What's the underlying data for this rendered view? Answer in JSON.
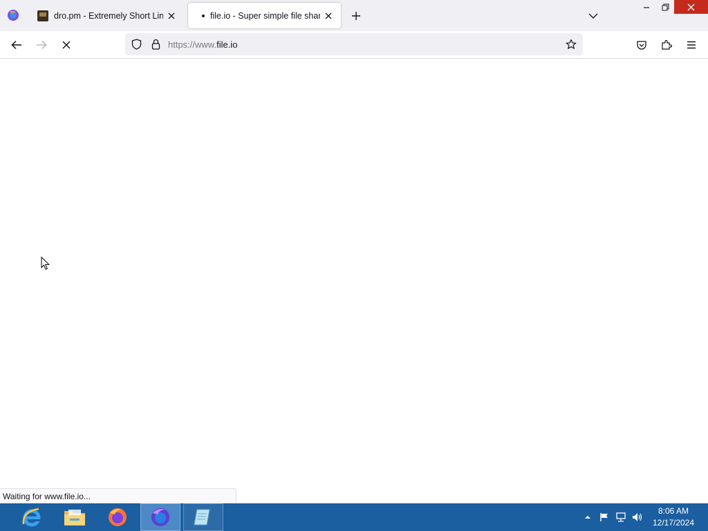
{
  "browser": {
    "tabs": [
      {
        "title": "dro.pm - Extremely Short Links",
        "active": false,
        "favicon": "dro-pm-favicon"
      },
      {
        "title": "file.io - Super simple file sharing",
        "active": true,
        "favicon": "loading-dot"
      }
    ],
    "url": {
      "scheme": "https://www.",
      "host": "file.io"
    },
    "status": "Waiting for www.file.io..."
  },
  "taskbar": {
    "items": [
      {
        "name": "internet-explorer",
        "icon": "ie-icon"
      },
      {
        "name": "file-explorer",
        "icon": "folder-icon"
      },
      {
        "name": "firefox",
        "icon": "firefox-icon"
      },
      {
        "name": "firefox-nightly",
        "icon": "firefox-nightly-icon",
        "active": true
      },
      {
        "name": "notepad-app",
        "icon": "notepad-icon"
      }
    ],
    "clock": {
      "time": "8:06 AM",
      "date": "12/17/2024"
    }
  },
  "colors": {
    "tabstrip_bg": "#f0f0f4",
    "urlbar_bg": "#f0f0f4",
    "taskbar_bg": "#1b5fa0",
    "close_button": "#c42b1c"
  }
}
